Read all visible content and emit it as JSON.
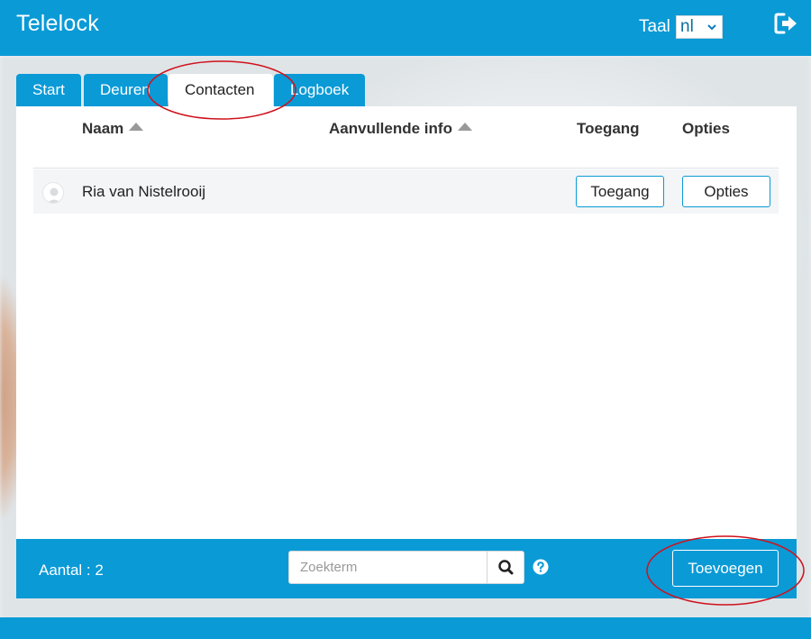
{
  "app": {
    "title": "Telelock"
  },
  "language": {
    "label": "Taal",
    "selected": "nl"
  },
  "tabs": [
    {
      "label": "Start",
      "active": false
    },
    {
      "label": "Deuren",
      "active": false
    },
    {
      "label": "Contacten",
      "active": true
    },
    {
      "label": "Logboek",
      "active": false
    }
  ],
  "table": {
    "headers": {
      "name": "Naam",
      "info": "Aanvullende info",
      "access": "Toegang",
      "options": "Opties"
    },
    "rows": [
      {
        "name": "Ria van Nistelrooij",
        "info": "",
        "access_button": "Toegang",
        "options_button": "Opties"
      }
    ]
  },
  "footer": {
    "count_label": "Aantal : 2",
    "search_placeholder": "Zoekterm",
    "add_button": "Toevoegen"
  },
  "colors": {
    "primary": "#0a9ad6",
    "annotation": "#d0111b"
  },
  "icons": {
    "logout": "logout-icon",
    "search": "search-icon",
    "help": "help-icon",
    "sort": "sort-asc-icon",
    "avatar": "user-avatar-icon",
    "dropdown": "chevron-down-icon"
  }
}
